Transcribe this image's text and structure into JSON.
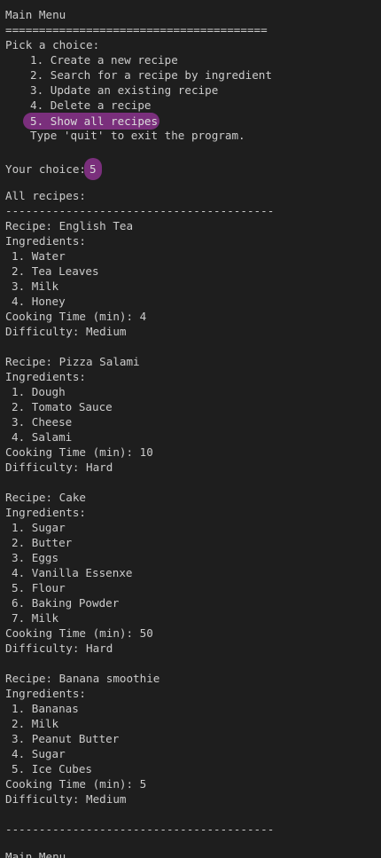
{
  "menu": {
    "title": "Main Menu",
    "rule": "=======================================",
    "prompt": "Pick a choice:",
    "options": [
      "1. Create a new recipe",
      "2. Search for a recipe by ingredient",
      "3. Update an existing recipe",
      "4. Delete a recipe",
      "5. Show all recipes"
    ],
    "quit_hint": "Type 'quit' to exit the program."
  },
  "choice": {
    "label": "Your choice:",
    "value": "5",
    "highlight_color": "#7a2f7c"
  },
  "listing": {
    "heading": "All recipes:",
    "separator": "----------------------------------------"
  },
  "recipes": [
    {
      "title": "Recipe: English Tea",
      "ingredients_label": "Ingredients:",
      "ingredients": [
        "1. Water",
        "2. Tea Leaves",
        "3. Milk",
        "4. Honey"
      ],
      "cooking_time": "Cooking Time (min): 4",
      "difficulty": "Difficulty: Medium"
    },
    {
      "title": "Recipe: Pizza Salami",
      "ingredients_label": "Ingredients:",
      "ingredients": [
        "1. Dough",
        "2. Tomato Sauce",
        "3. Cheese",
        "4. Salami"
      ],
      "cooking_time": "Cooking Time (min): 10",
      "difficulty": "Difficulty: Hard"
    },
    {
      "title": "Recipe: Cake",
      "ingredients_label": "Ingredients:",
      "ingredients": [
        "1. Sugar",
        "2. Butter",
        "3. Eggs",
        "4. Vanilla Essenxe",
        "5. Flour",
        "6. Baking Powder",
        "7. Milk"
      ],
      "cooking_time": "Cooking Time (min): 50",
      "difficulty": "Difficulty: Hard"
    },
    {
      "title": "Recipe: Banana smoothie",
      "ingredients_label": "Ingredients:",
      "ingredients": [
        "1. Bananas",
        "2. Milk",
        "3. Peanut Butter",
        "4. Sugar",
        "5. Ice Cubes"
      ],
      "cooking_time": "Cooking Time (min): 5",
      "difficulty": "Difficulty: Medium"
    }
  ],
  "footer": {
    "separator": "----------------------------------------",
    "next_title": "Main Menu"
  }
}
